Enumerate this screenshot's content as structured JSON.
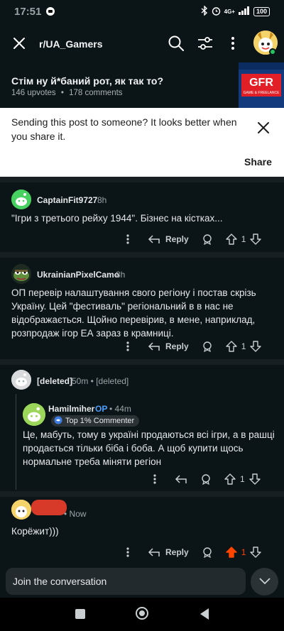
{
  "status": {
    "time": "17:51",
    "network": "4G+",
    "battery": "100"
  },
  "header": {
    "subreddit": "r/UA_Gamers"
  },
  "post": {
    "title": "Стім ну й*баний рот, як так то?",
    "upvotes": "146 upvotes",
    "dot": "•",
    "comments": "178 comments",
    "thumbnail_text": "GFR",
    "thumbnail_subtext": "GAME & FREELANCE"
  },
  "share_banner": {
    "message": "Sending this post to someone? It looks better when you share it.",
    "button": "Share"
  },
  "comments": [
    {
      "user": "CaptainFit9727",
      "time": "8h",
      "text": "\"Ігри з третього рейху 1944\". Бізнес на кістках...",
      "reply": "Reply",
      "votes": "1"
    },
    {
      "user": "UkrainianPixelCamo",
      "time": "8h",
      "text": "ОП перевір налаштування свого регіону і постав скрізь Україну. Цей \"фестиваль\" регіональний в в нас не відображається. Щойно перевірив, в мене, наприклад, розпродаж ігор ЕА зараз в крамниці.",
      "reply": "Reply",
      "votes": "1"
    },
    {
      "user": "[deleted]",
      "time": "50m • [deleted]"
    },
    {
      "user": "Hamilmiher",
      "op": "OP",
      "time": "• 44m",
      "badge": "Top 1% Commenter",
      "text": "Це, мабуть, тому в україні продаються всі ігри, а в рашці продається тільки біба і боба. А щоб купити щось нормальне треба міняти регіон",
      "votes": "1"
    },
    {
      "time": "• Now",
      "text": "Корёжит)))",
      "reply": "Reply",
      "votes": "1"
    }
  ],
  "composer": {
    "placeholder": "Join the conversation"
  },
  "colors": {
    "background": "#0b1416",
    "upvoted": "#ff4500",
    "op": "#4c9fff",
    "online": "#22c55e"
  }
}
